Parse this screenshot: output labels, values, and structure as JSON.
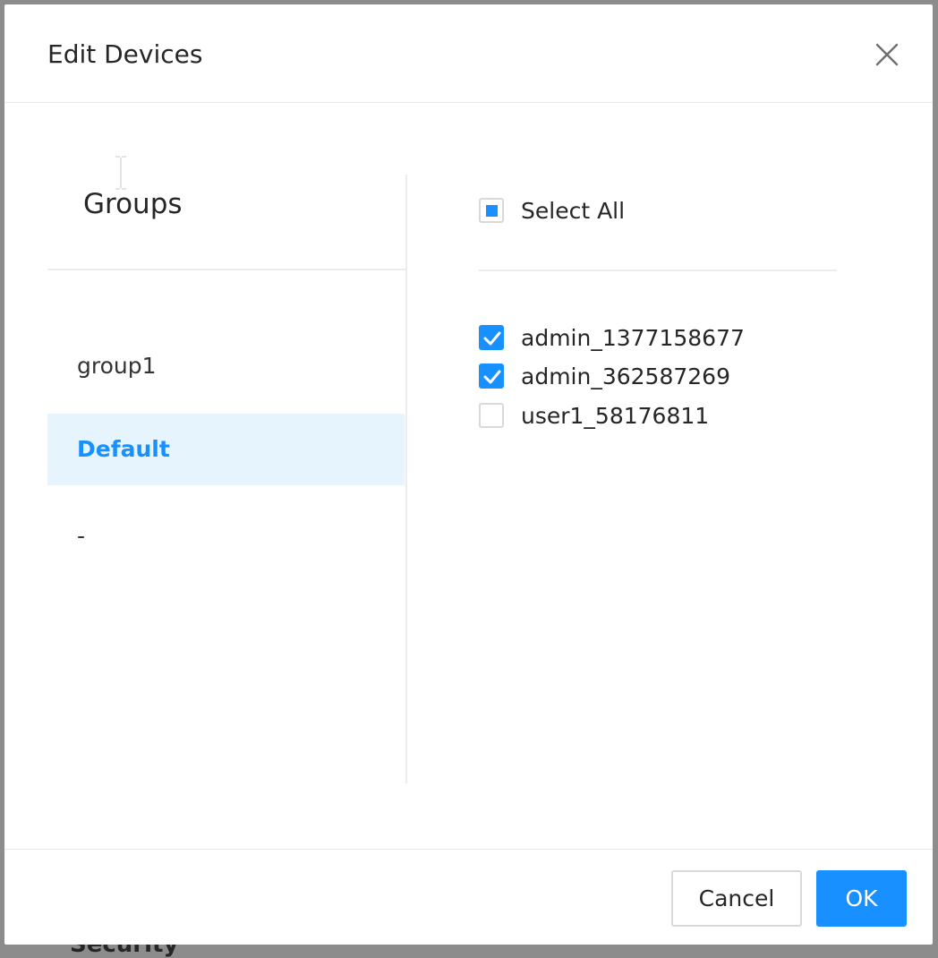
{
  "modal": {
    "title": "Edit Devices",
    "close_icon": "close-icon"
  },
  "groups": {
    "title": "Groups",
    "items": [
      {
        "label": "group1",
        "selected": false
      },
      {
        "label": "Default",
        "selected": true
      },
      {
        "label": "-",
        "selected": false
      }
    ]
  },
  "devices": {
    "select_all_label": "Select All",
    "select_all_state": "indeterminate",
    "items": [
      {
        "label": "admin_1377158677",
        "checked": true
      },
      {
        "label": "admin_362587269",
        "checked": true
      },
      {
        "label": "user1_58176811",
        "checked": false
      }
    ]
  },
  "footer": {
    "cancel_label": "Cancel",
    "ok_label": "OK"
  },
  "background": {
    "peek_text": "Security"
  },
  "colors": {
    "accent": "#1890ff",
    "selected_bg": "#e6f4fd",
    "overlay": "#8c8c8c"
  }
}
